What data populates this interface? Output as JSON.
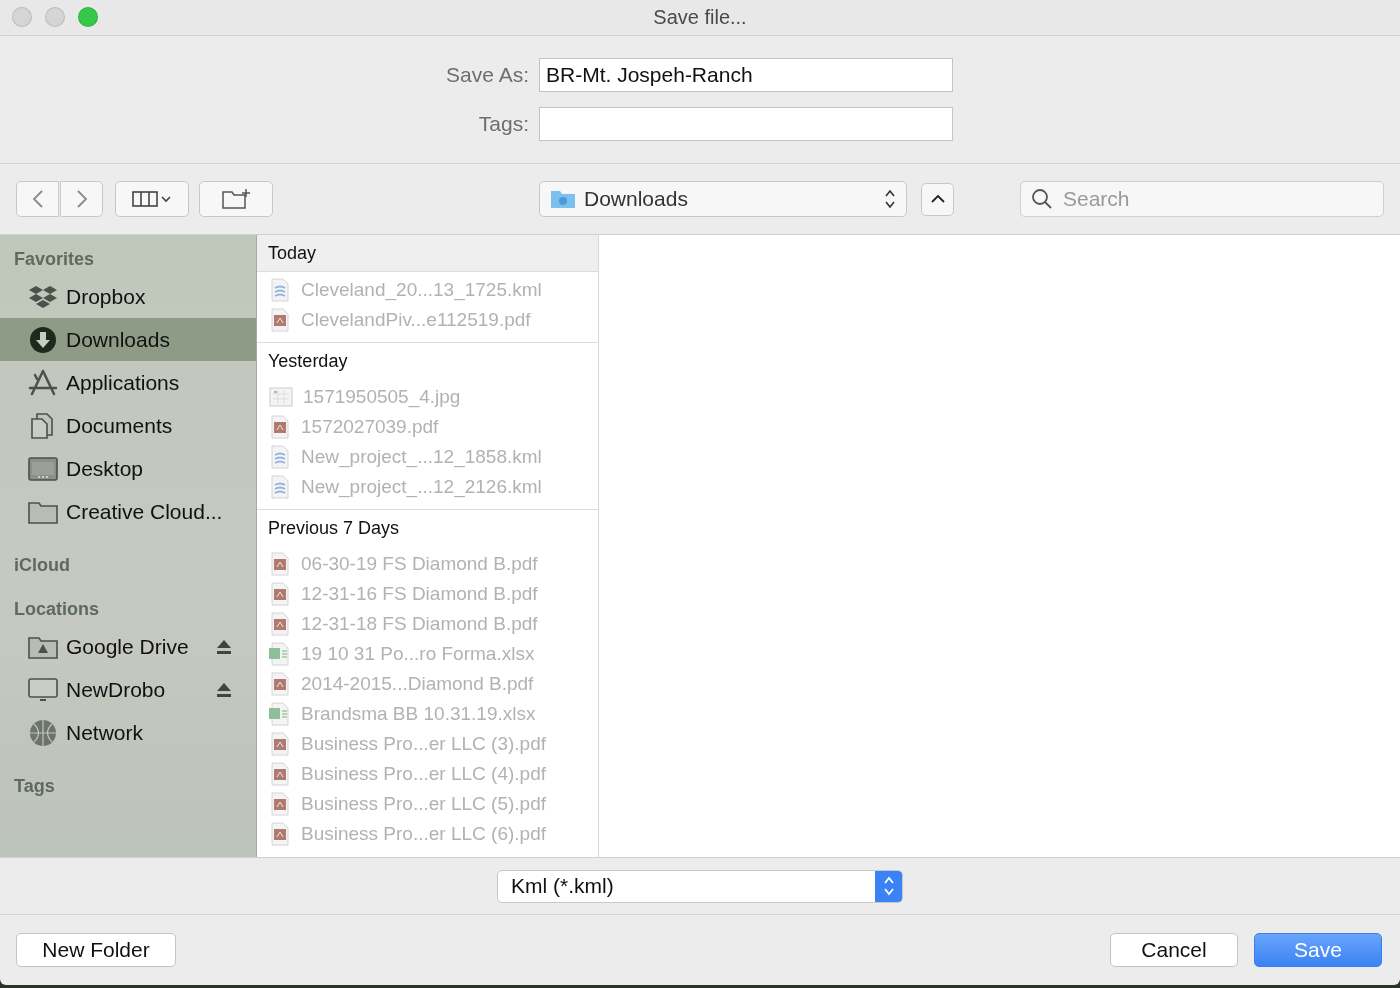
{
  "window": {
    "title": "Save file..."
  },
  "form": {
    "save_as": {
      "label": "Save As:",
      "value": "BR-Mt. Jospeh-Ranch"
    },
    "tags": {
      "label": "Tags:"
    }
  },
  "toolbar": {
    "location": "Downloads",
    "search": {
      "placeholder": "Search"
    }
  },
  "sidebar": [
    {
      "title": "Favorites",
      "items": [
        {
          "label": "Dropbox",
          "kind": "dropbox",
          "selected": false,
          "eject": false
        },
        {
          "label": "Downloads",
          "kind": "downloads",
          "selected": true,
          "eject": false
        },
        {
          "label": "Applications",
          "kind": "applications",
          "selected": false,
          "eject": false
        },
        {
          "label": "Documents",
          "kind": "documents",
          "selected": false,
          "eject": false
        },
        {
          "label": "Desktop",
          "kind": "desktop",
          "selected": false,
          "eject": false
        },
        {
          "label": "Creative Cloud...",
          "kind": "folder",
          "selected": false,
          "eject": false
        }
      ]
    },
    {
      "title": "iCloud"
    },
    {
      "title": "Locations",
      "items": [
        {
          "label": "Google Drive",
          "kind": "drive",
          "selected": false,
          "eject": true
        },
        {
          "label": "NewDrobo",
          "kind": "monitor",
          "selected": false,
          "eject": true
        },
        {
          "label": "Network",
          "kind": "network",
          "selected": false,
          "eject": false
        }
      ]
    },
    {
      "title": "Tags"
    }
  ],
  "files": [
    {
      "title": "Today",
      "items": [
        {
          "name": "Cleveland_20...13_1725.kml",
          "kind": "kml",
          "disabled": true
        },
        {
          "name": "ClevelandPiv...e112519.pdf",
          "kind": "pdf",
          "disabled": true
        }
      ]
    },
    {
      "title": "Yesterday",
      "items": [
        {
          "name": "1571950505_4.jpg",
          "kind": "jpg",
          "disabled": true
        },
        {
          "name": "1572027039.pdf",
          "kind": "pdf",
          "disabled": true
        },
        {
          "name": "New_project_...12_1858.kml",
          "kind": "kml",
          "disabled": true
        },
        {
          "name": "New_project_...12_2126.kml",
          "kind": "kml",
          "disabled": true
        }
      ]
    },
    {
      "title": "Previous 7 Days",
      "items": [
        {
          "name": "06-30-19 FS Diamond B.pdf",
          "kind": "pdf",
          "disabled": true
        },
        {
          "name": "12-31-16 FS Diamond B.pdf",
          "kind": "pdf",
          "disabled": true
        },
        {
          "name": "12-31-18 FS Diamond B.pdf",
          "kind": "pdf",
          "disabled": true
        },
        {
          "name": "19 10 31 Po...ro Forma.xlsx",
          "kind": "xlsx",
          "disabled": true
        },
        {
          "name": "2014-2015...Diamond B.pdf",
          "kind": "pdf",
          "disabled": true
        },
        {
          "name": "Brandsma BB 10.31.19.xlsx",
          "kind": "xlsx",
          "disabled": true
        },
        {
          "name": "Business Pro...er LLC (3).pdf",
          "kind": "pdf",
          "disabled": true
        },
        {
          "name": "Business Pro...er LLC (4).pdf",
          "kind": "pdf",
          "disabled": true
        },
        {
          "name": "Business Pro...er LLC (5).pdf",
          "kind": "pdf",
          "disabled": true
        },
        {
          "name": "Business Pro...er LLC (6).pdf",
          "kind": "pdf",
          "disabled": true
        }
      ]
    }
  ],
  "format": "Kml (*.kml)",
  "buttons": {
    "new_folder": "New Folder",
    "cancel": "Cancel",
    "save": "Save"
  }
}
